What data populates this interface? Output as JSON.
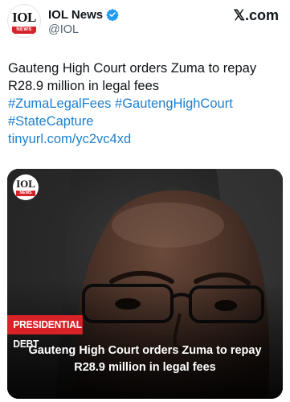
{
  "account": {
    "logo_text": "IOL",
    "logo_sub": "NEWS",
    "display_name": "IOL News",
    "handle": "@IOL",
    "verified_icon": "verified-badge-icon"
  },
  "brand": {
    "label": "𝕏.com"
  },
  "post": {
    "text_line1": "Gauteng High Court orders Zuma to repay",
    "text_line2": "R28.9 million in legal fees",
    "hashtag_1": "#ZumaLegalFees",
    "hashtag_2": "#GautengHighCourt",
    "hashtag_3": "#StateCapture",
    "link": "tinyurl.com/yc2vc4xd"
  },
  "card": {
    "logo_text": "IOL",
    "logo_sub": "NEWS",
    "tag": "PRESIDENTIAL DEBT",
    "headline_line1": "Gauteng High Court orders Zuma to repay",
    "headline_line2": "R28.9 million in legal fees"
  },
  "colors": {
    "link": "#1d7fd0",
    "tag_red": "#d92128",
    "verified_blue": "#1d9bf0"
  }
}
